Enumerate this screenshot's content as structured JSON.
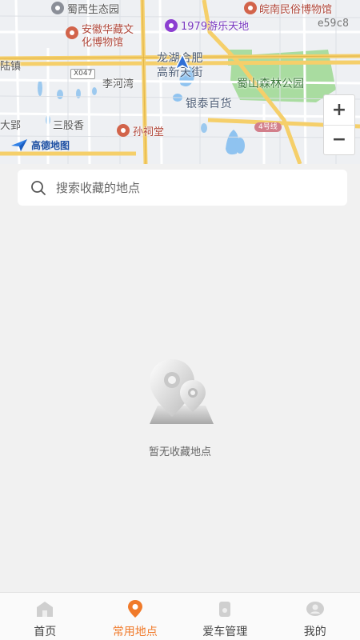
{
  "map": {
    "labels": {
      "shuxi_park": "蜀西生态园",
      "folk_museum": "皖南民俗博物馆",
      "huazang_museum_line1": "安徽华藏文",
      "huazang_museum_line2": "化博物馆",
      "amusement": "1979游乐天地",
      "town": "陆镇",
      "longhu": "龙湖合肥",
      "gaoxin": "高新天街",
      "road": "X047",
      "lihewan": "李河湾",
      "shushan_park": "蜀山森林公园",
      "yintai": "银泰百货",
      "dayin": "大郢",
      "sangugu": "三股香",
      "suncitang": "孙祠堂",
      "metro": "4号线"
    },
    "map_id": "e59c8",
    "logo_text": "高德地图",
    "zoom_in": "+",
    "zoom_out": "−"
  },
  "search": {
    "placeholder": "搜索收藏的地点"
  },
  "empty_state": {
    "message": "暂无收藏地点"
  },
  "tabs": [
    {
      "label": "首页",
      "icon": "home-icon",
      "active": false
    },
    {
      "label": "常用地点",
      "icon": "location-pin-icon",
      "active": true
    },
    {
      "label": "爱车管理",
      "icon": "car-manage-icon",
      "active": false
    },
    {
      "label": "我的",
      "icon": "user-icon",
      "active": false
    }
  ],
  "colors": {
    "accent": "#f07a2a",
    "background": "#f1f1f1",
    "park_green": "#a9dca0",
    "highway_yellow": "#f5cf6a"
  }
}
